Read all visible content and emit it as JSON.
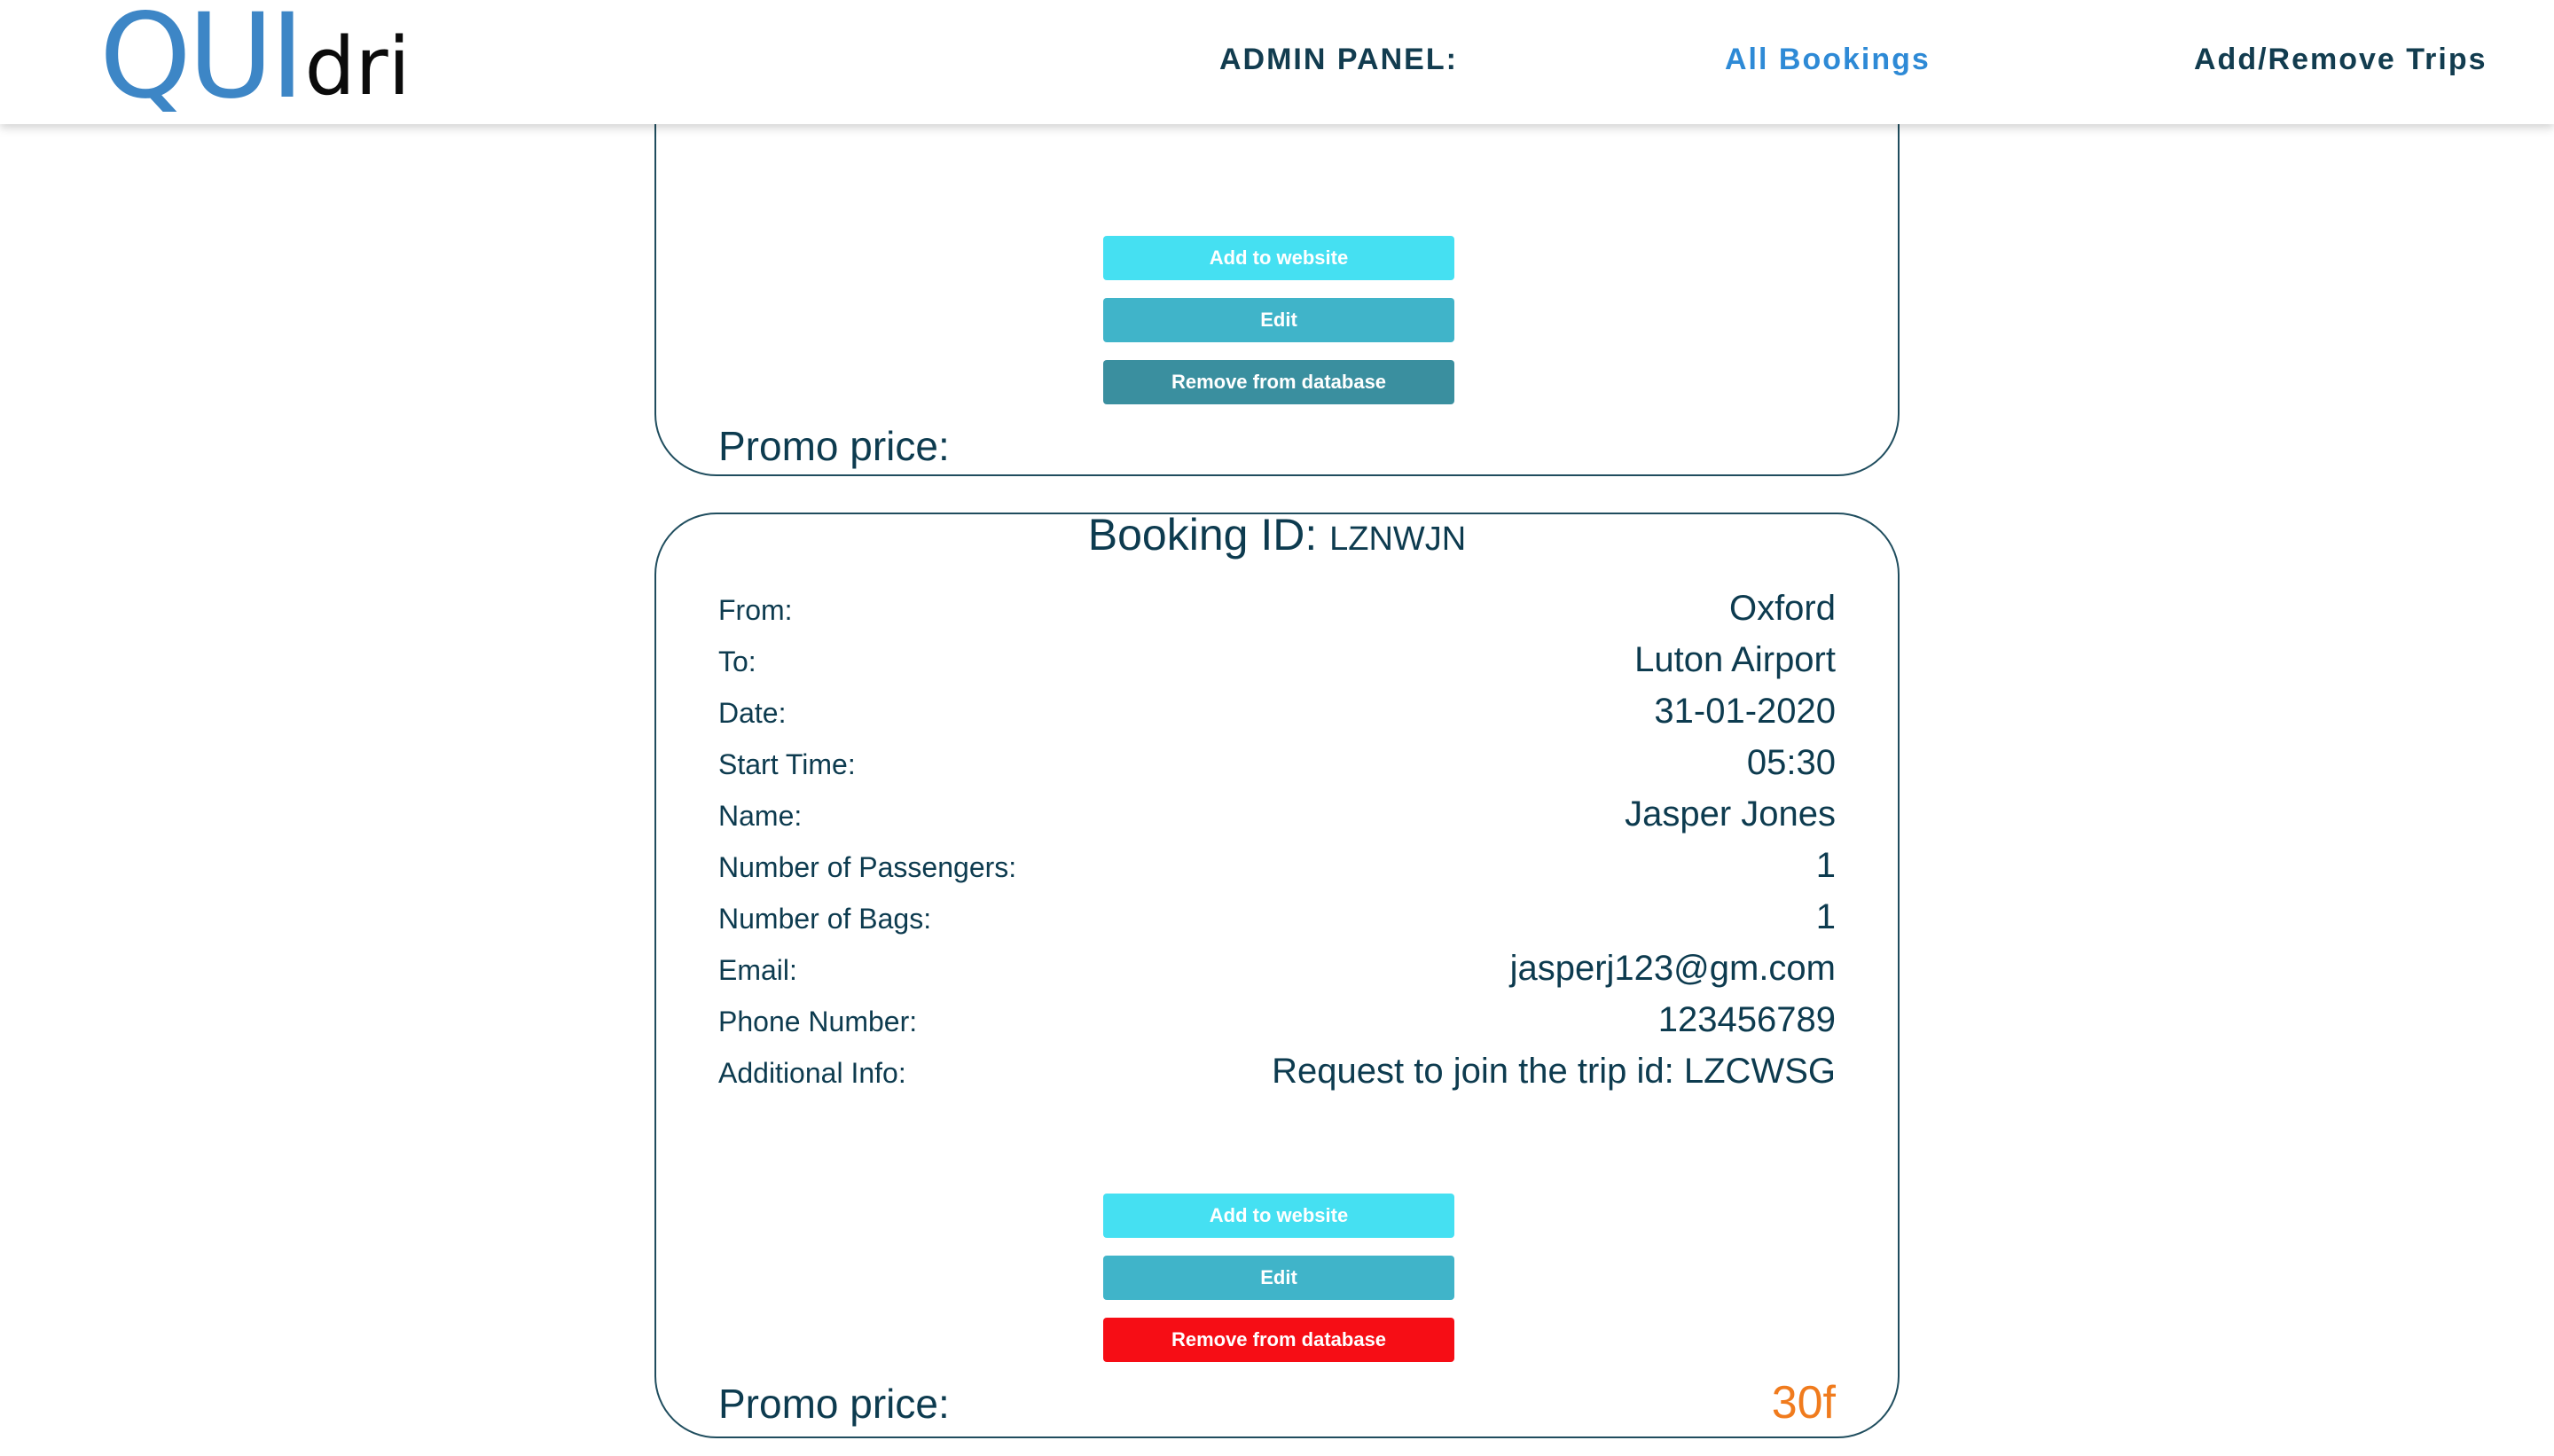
{
  "header": {
    "logo_main": "QUI",
    "logo_sub": "dri",
    "admin_label": "ADMIN PANEL:",
    "nav_all_bookings": "All Bookings",
    "nav_add_remove_trips": "Add/Remove Trips"
  },
  "cards": [
    {
      "buttons": {
        "add": "Add to website",
        "edit": "Edit",
        "remove": "Remove from database"
      },
      "promo_label": "Promo price:",
      "promo_value": ""
    },
    {
      "title_label": "Booking ID:",
      "booking_id": "LZNWJN",
      "fields": [
        {
          "label": "From:",
          "value": "Oxford"
        },
        {
          "label": "To:",
          "value": "Luton Airport"
        },
        {
          "label": "Date:",
          "value": "31-01-2020"
        },
        {
          "label": "Start Time:",
          "value": "05:30"
        },
        {
          "label": "Name:",
          "value": "Jasper Jones"
        },
        {
          "label": "Number of Passengers:",
          "value": "1"
        },
        {
          "label": "Number of Bags:",
          "value": "1"
        },
        {
          "label": "Email:",
          "value": "jasperj123@gm.com"
        },
        {
          "label": "Phone Number:",
          "value": "123456789"
        },
        {
          "label": "Additional Info:",
          "value": "Request to join the trip id: LZCWSG"
        }
      ],
      "buttons": {
        "add": "Add to website",
        "edit": "Edit",
        "remove": "Remove from database"
      },
      "promo_label": "Promo price:",
      "promo_value": "30f"
    }
  ],
  "colors": {
    "brand_blue": "#3d86c6",
    "nav_active": "#2e8ad6",
    "text_dark": "#0d3b4f",
    "btn_add": "#45e0f2",
    "btn_edit": "#40b4c9",
    "btn_remove_muted": "#3a8f9f",
    "btn_remove_red": "#f60d15",
    "promo_orange": "#f07b1d"
  }
}
